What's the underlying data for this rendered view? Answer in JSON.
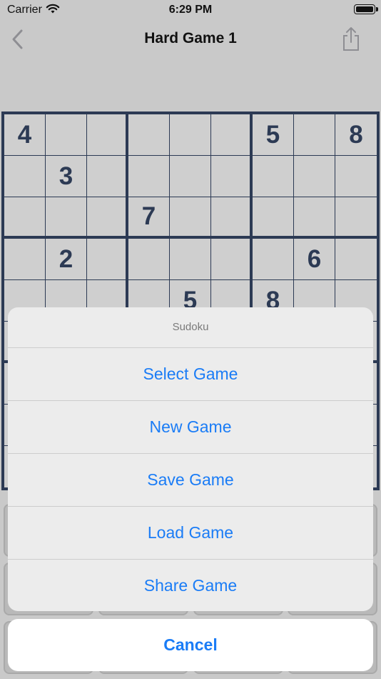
{
  "status_bar": {
    "carrier": "Carrier",
    "time": "6:29 PM"
  },
  "nav": {
    "title": "Hard Game 1"
  },
  "grid": {
    "rows": [
      [
        "4",
        "",
        "",
        "",
        "",
        "",
        "5",
        "",
        "8"
      ],
      [
        "",
        "3",
        "",
        "",
        "",
        "",
        "",
        "",
        ""
      ],
      [
        "",
        "",
        "",
        "7",
        "",
        "",
        "",
        "",
        ""
      ],
      [
        "",
        "2",
        "",
        "",
        "",
        "",
        "",
        "6",
        ""
      ],
      [
        "",
        "",
        "",
        "",
        "5",
        "",
        "8",
        "",
        ""
      ],
      [
        "",
        "",
        "",
        "",
        "",
        "",
        "",
        "",
        ""
      ],
      [
        "",
        "",
        "",
        "",
        "",
        "",
        "",
        "",
        ""
      ],
      [
        "",
        "",
        "",
        "",
        "",
        "",
        "",
        "",
        ""
      ],
      [
        "",
        "",
        "",
        "",
        "",
        "",
        "",
        "",
        ""
      ]
    ]
  },
  "action_sheet": {
    "title": "Sudoku",
    "actions": [
      "Select Game",
      "New Game",
      "Save Game",
      "Load Game",
      "Share Game"
    ],
    "cancel": "Cancel"
  },
  "colors": {
    "accent": "#1a7cf6",
    "grid_line": "#2c3a54",
    "background": "#c9c9c9"
  }
}
